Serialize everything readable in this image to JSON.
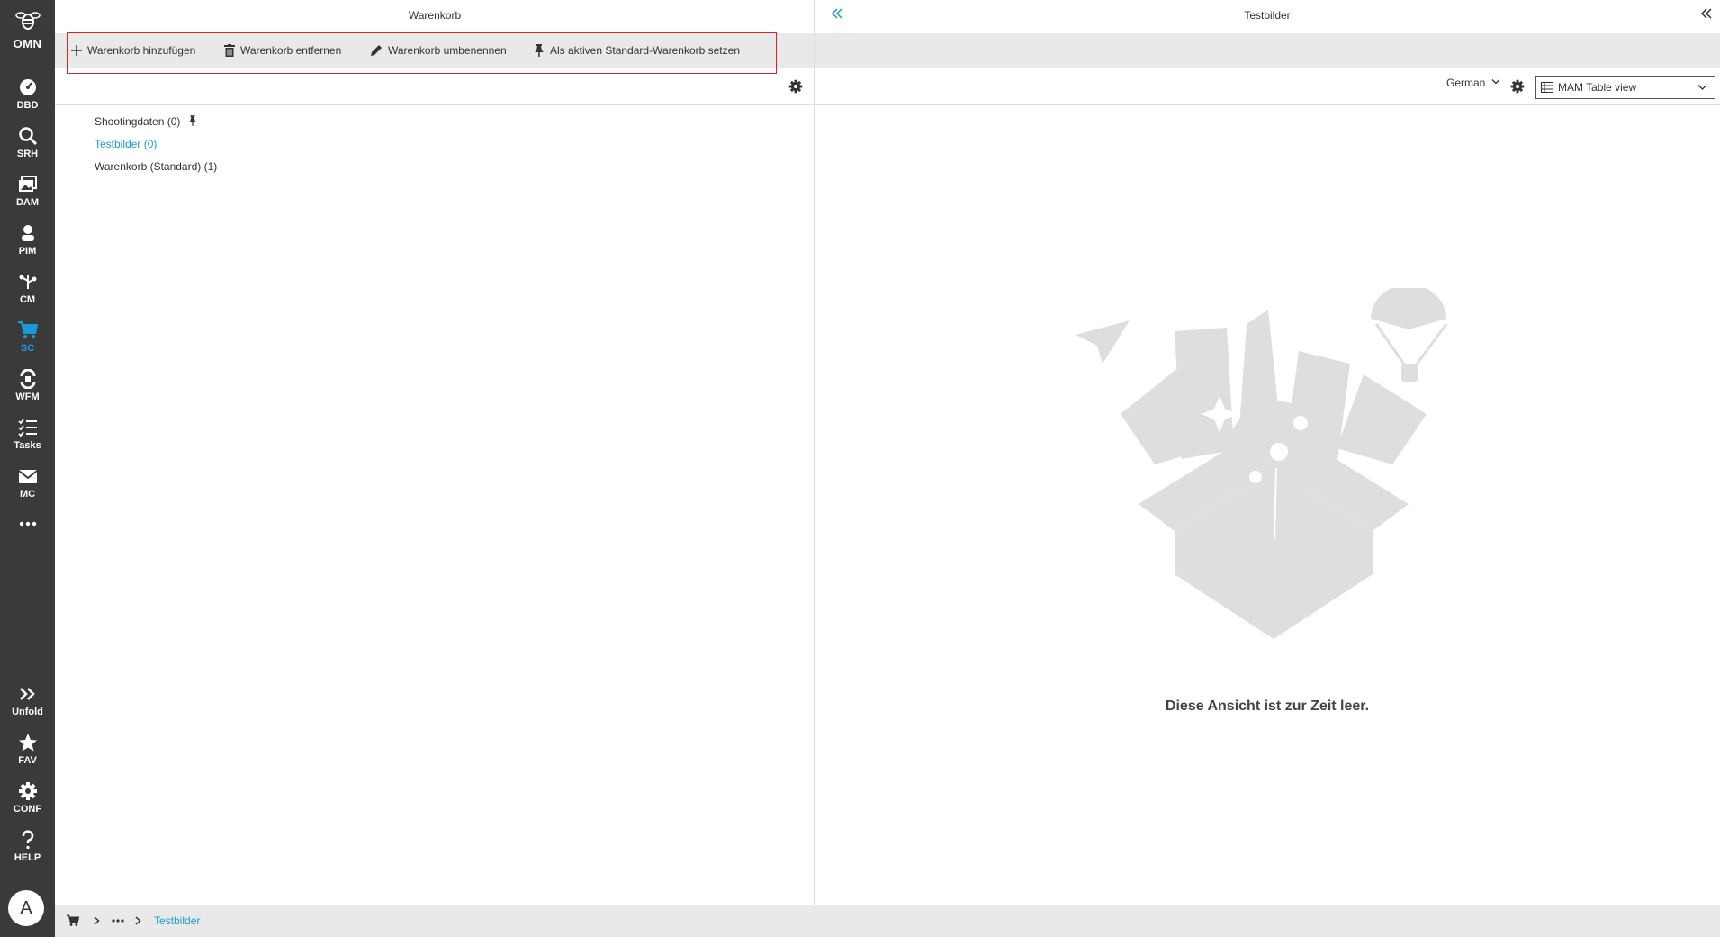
{
  "sidebar": {
    "logo_label": "OMN",
    "items": [
      {
        "label": "DBD",
        "icon": "dashboard-icon"
      },
      {
        "label": "SRH",
        "icon": "search-icon"
      },
      {
        "label": "DAM",
        "icon": "images-icon"
      },
      {
        "label": "PIM",
        "icon": "product-icon"
      },
      {
        "label": "CM",
        "icon": "network-icon"
      },
      {
        "label": "SC",
        "icon": "cart-icon"
      },
      {
        "label": "WFM",
        "icon": "workflow-icon"
      },
      {
        "label": "Tasks",
        "icon": "tasks-icon"
      },
      {
        "label": "MC",
        "icon": "mail-icon"
      }
    ],
    "more_icon": "more-icon",
    "bottom_items": [
      {
        "label": "Unfold",
        "icon": "double-chevron-right-icon"
      },
      {
        "label": "FAV",
        "icon": "star-icon"
      },
      {
        "label": "CONF",
        "icon": "gear-icon"
      },
      {
        "label": "HELP",
        "icon": "question-icon"
      }
    ],
    "avatar_initial": "A"
  },
  "left_pane": {
    "title": "Warenkorb",
    "toolbar": {
      "add_label": "Warenkorb hinzufügen",
      "remove_label": "Warenkorb entfernen",
      "rename_label": "Warenkorb umbenennen",
      "set_default_label": "Als aktiven Standard-Warenkorb setzen"
    },
    "tree": [
      {
        "label": "Shootingdaten (0)",
        "pinned": true,
        "selected": false
      },
      {
        "label": "Testbilder (0)",
        "pinned": false,
        "selected": true
      },
      {
        "label": "Warenkorb (Standard) (1)",
        "pinned": false,
        "selected": false
      }
    ]
  },
  "right_pane": {
    "title": "Testbilder",
    "language": "German",
    "view_mode": "MAM Table view",
    "empty_message": "Diese Ansicht ist zur Zeit leer."
  },
  "footer": {
    "breadcrumb_current": "Testbilder"
  },
  "colors": {
    "accent": "#1a9ad6",
    "sidebar_bg": "#3a3a3a",
    "highlight_border": "#e0212e"
  }
}
